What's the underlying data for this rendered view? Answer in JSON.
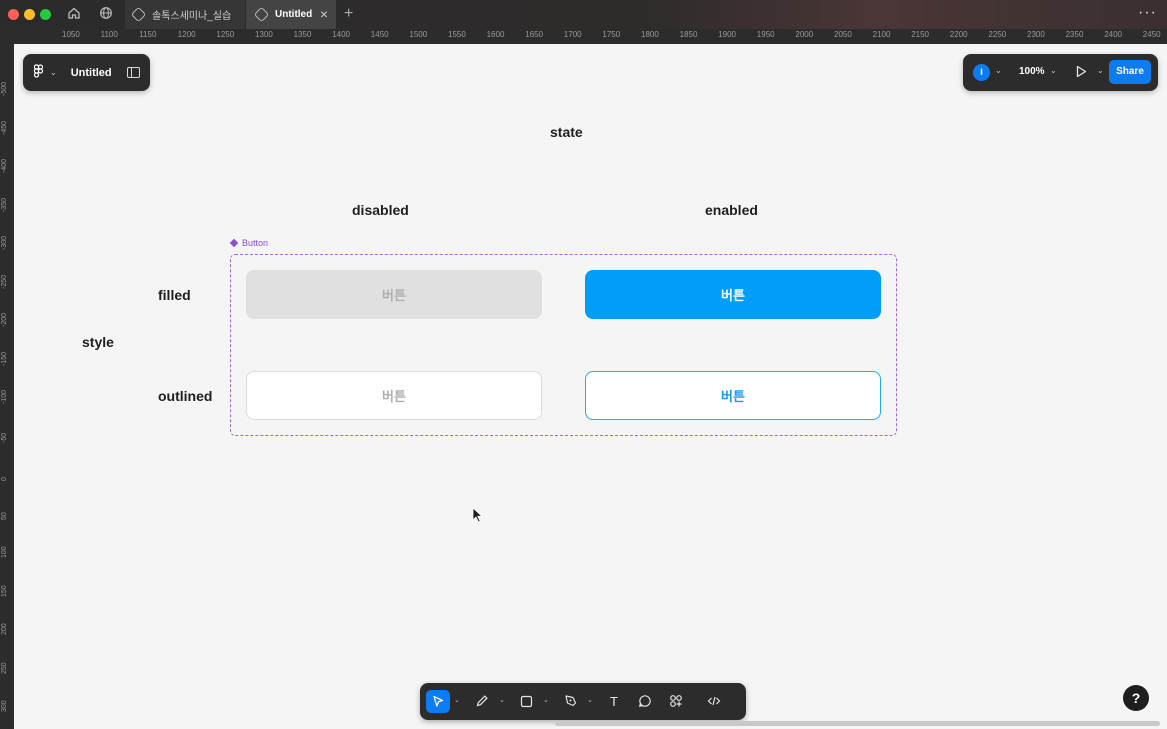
{
  "browser": {
    "tabs": [
      {
        "label": "솔톡스세미나_실습",
        "active": false
      },
      {
        "label": "Untitled",
        "active": true
      }
    ],
    "new_tab_symbol": "+",
    "more_symbol": "···"
  },
  "ruler": {
    "top_ticks": [
      "1050",
      "1100",
      "1150",
      "1200",
      "1250",
      "1300",
      "1350",
      "1400",
      "1450",
      "1500",
      "1550",
      "1600",
      "1650",
      "1700",
      "1750",
      "1800",
      "1850",
      "1900",
      "1950",
      "2000",
      "2050",
      "2100",
      "2150",
      "2200",
      "2250",
      "2300",
      "2350",
      "2400",
      "2450"
    ],
    "left_ticks": [
      "-500",
      "-450",
      "-400",
      "-350",
      "-300",
      "-250",
      "-200",
      "-150",
      "-100",
      "-50",
      "0",
      "50",
      "100",
      "150",
      "200",
      "250",
      "300"
    ]
  },
  "header_left": {
    "logo_icon": "figma-logo-icon",
    "file_title": "Untitled"
  },
  "header_right": {
    "avatar_initial": "I",
    "zoom": "100%",
    "share_label": "Share",
    "accent_color": "#0d7cf2"
  },
  "design": {
    "state_label": "state",
    "disabled_label": "disabled",
    "enabled_label": "enabled",
    "style_label": "style",
    "filled_label": "filled",
    "outlined_label": "outlined",
    "component_set_label": "Button",
    "buttons": {
      "filled_disabled": "버튼",
      "filled_enabled": "버튼",
      "outlined_disabled": "버튼",
      "outlined_enabled": "버튼"
    },
    "colors": {
      "filled_enabled": "#009ef7",
      "filled_disabled": "#e0e0e0",
      "component_purple": "#9b6ae0"
    }
  },
  "toolbar": {
    "tools": [
      "move-icon",
      "pencil-icon",
      "frame-icon",
      "pen-icon",
      "text-icon",
      "comment-icon",
      "components-icon",
      "code-icon"
    ],
    "text_tool_glyph": "T"
  },
  "help_label": "?"
}
